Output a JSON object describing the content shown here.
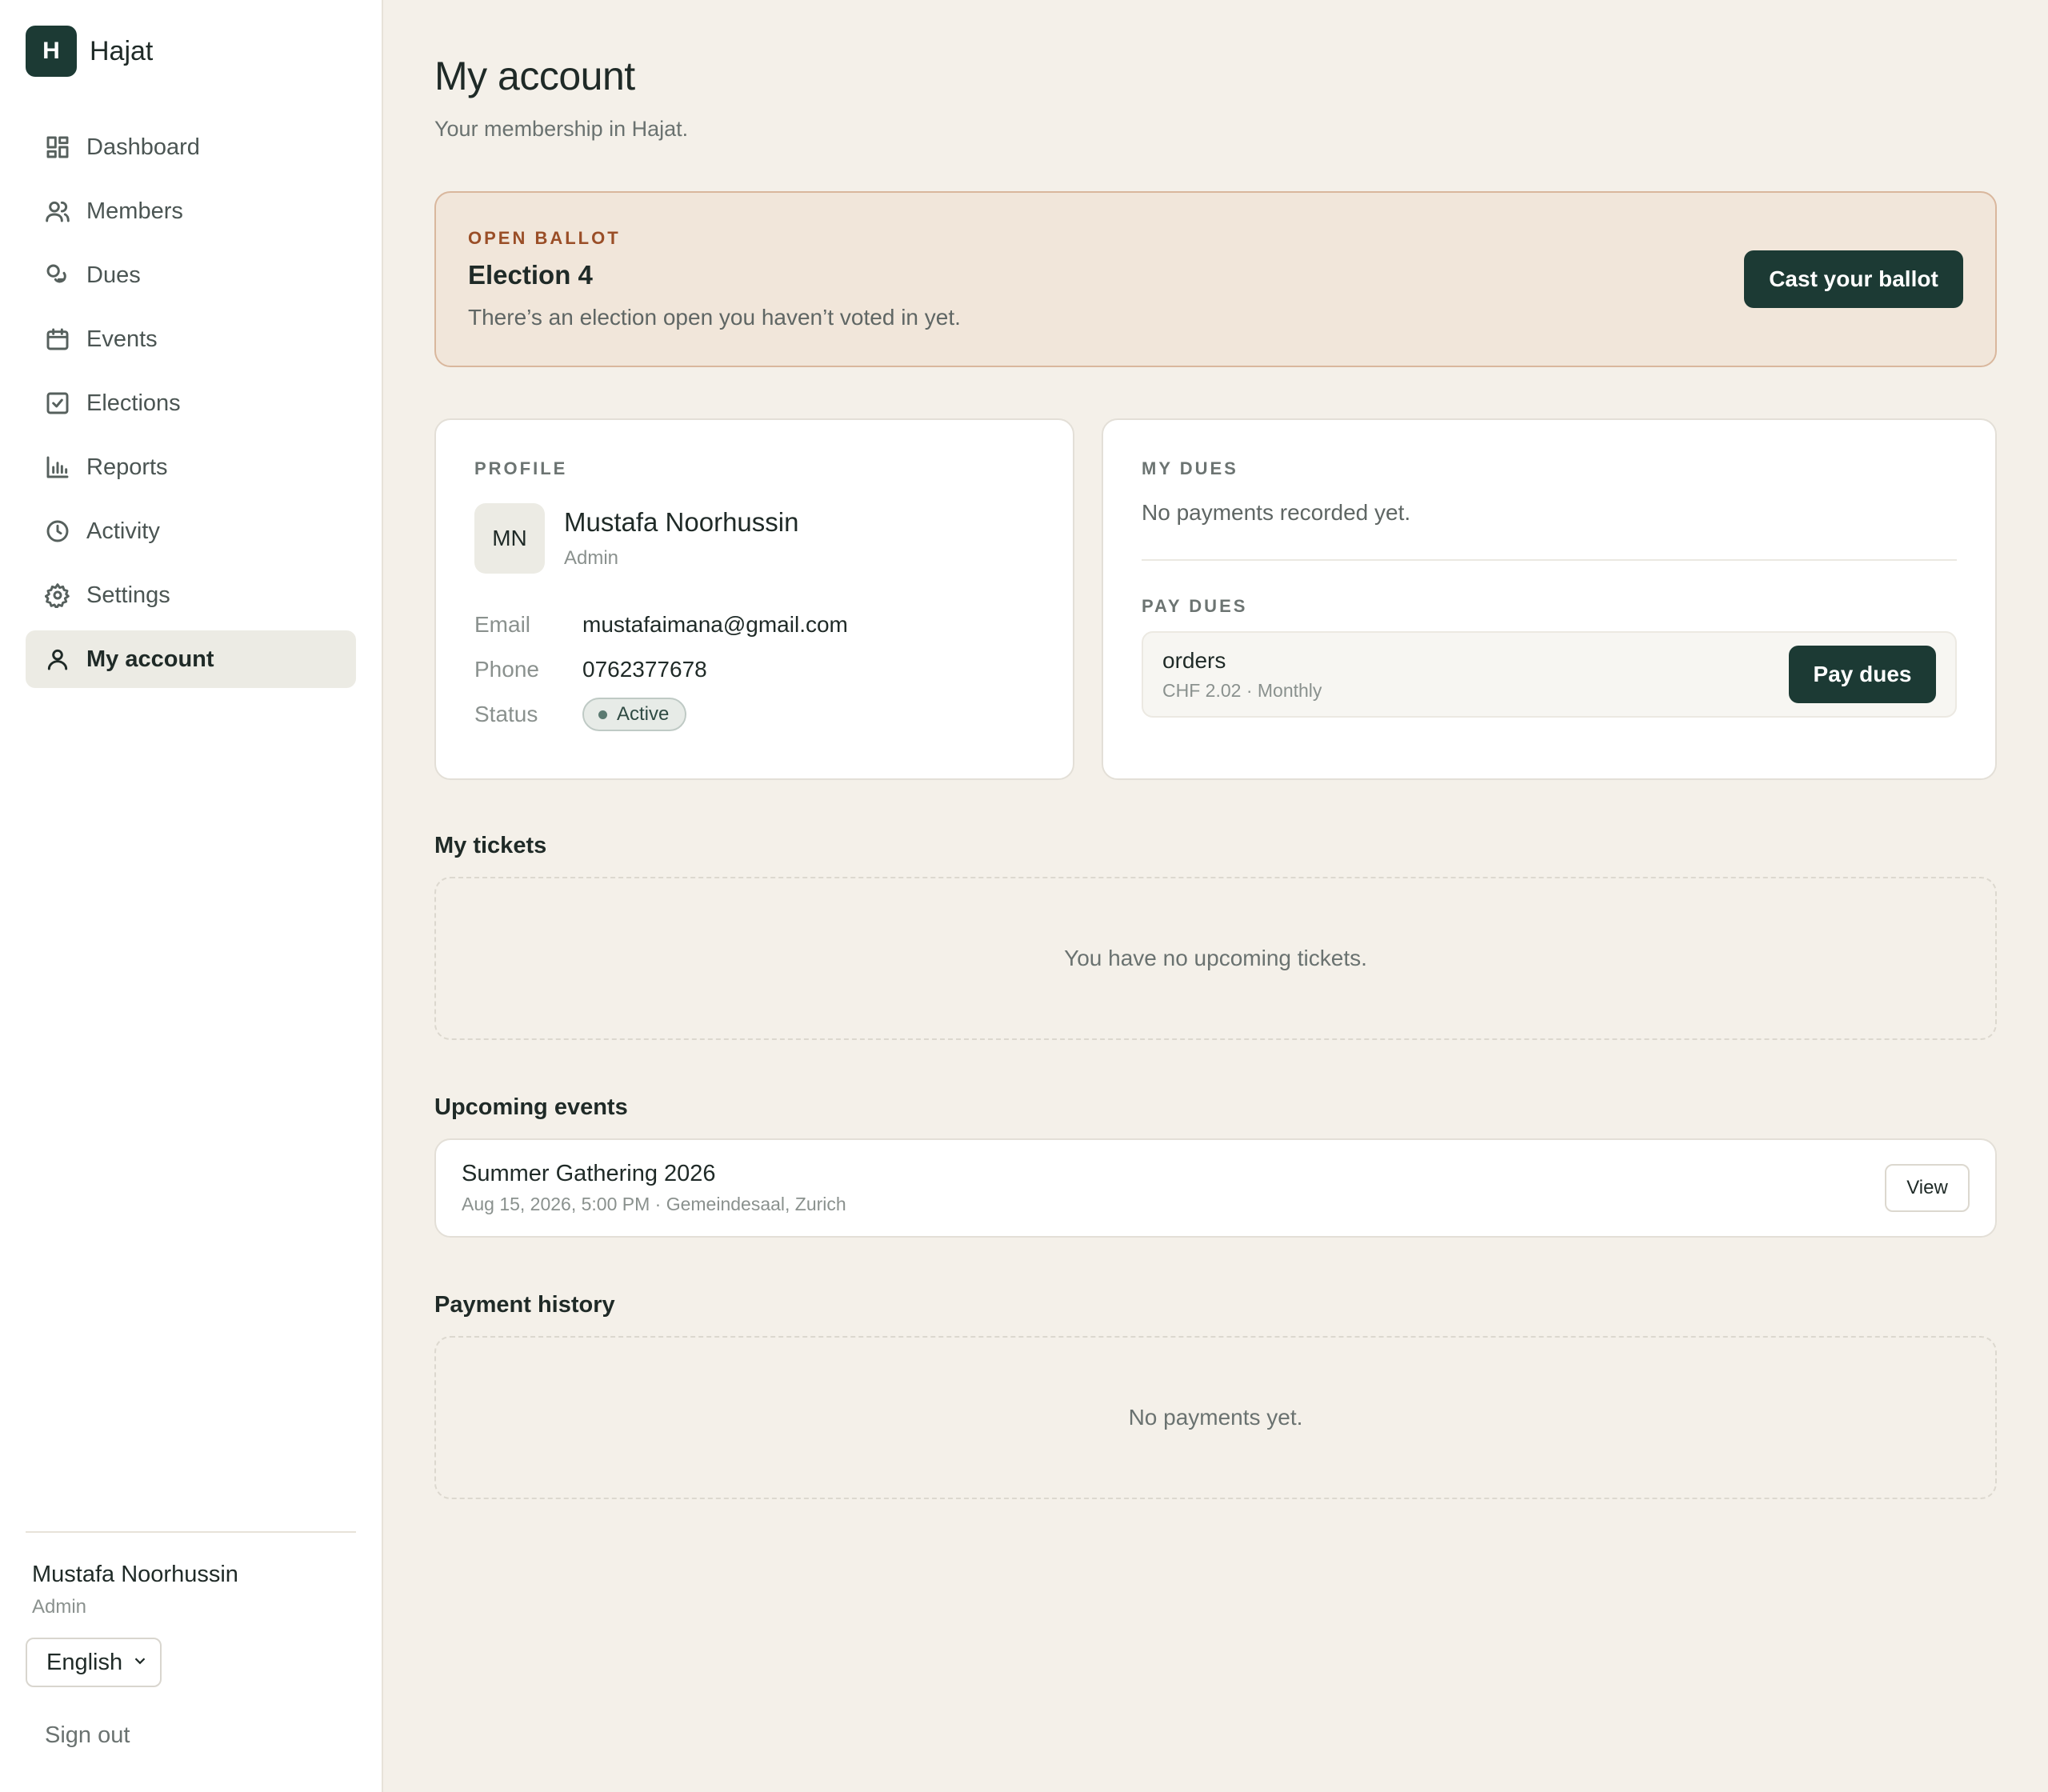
{
  "brand": {
    "logo_letter": "H",
    "name": "Hajat"
  },
  "nav": {
    "items": [
      {
        "label": "Dashboard",
        "icon": "dashboard-icon"
      },
      {
        "label": "Members",
        "icon": "members-icon"
      },
      {
        "label": "Dues",
        "icon": "dues-icon"
      },
      {
        "label": "Events",
        "icon": "calendar-icon"
      },
      {
        "label": "Elections",
        "icon": "checkbox-icon"
      },
      {
        "label": "Reports",
        "icon": "bar-chart-icon"
      },
      {
        "label": "Activity",
        "icon": "clock-icon"
      },
      {
        "label": "Settings",
        "icon": "gear-icon"
      },
      {
        "label": "My account",
        "icon": "user-icon",
        "active": true
      }
    ]
  },
  "sidebar_footer": {
    "user_name": "Mustafa Noorhussin",
    "user_role": "Admin",
    "language": "English",
    "sign_out": "Sign out"
  },
  "page": {
    "title": "My account",
    "subtitle": "Your membership in Hajat."
  },
  "ballot": {
    "kicker": "OPEN BALLOT",
    "title": "Election 4",
    "description": "There’s an election open you haven’t voted in yet.",
    "button": "Cast your ballot"
  },
  "profile": {
    "kicker": "PROFILE",
    "initials": "MN",
    "name": "Mustafa Noorhussin",
    "role": "Admin",
    "email_label": "Email",
    "email": "mustafaimana@gmail.com",
    "phone_label": "Phone",
    "phone": "0762377678",
    "status_label": "Status",
    "status": "Active"
  },
  "dues": {
    "kicker": "MY DUES",
    "empty": "No payments recorded yet.",
    "pay_kicker": "PAY DUES",
    "item_name": "orders",
    "item_meta": "CHF 2.02 · Monthly",
    "pay_button": "Pay dues"
  },
  "tickets": {
    "title": "My tickets",
    "empty": "You have no upcoming tickets."
  },
  "events": {
    "title": "Upcoming events",
    "items": [
      {
        "name": "Summer Gathering 2026",
        "meta": "Aug 15, 2026, 5:00 PM · Gemeindesaal, Zurich",
        "button": "View"
      }
    ]
  },
  "payments": {
    "title": "Payment history",
    "empty": "No payments yet."
  },
  "colors": {
    "accent": "#1c3a34",
    "background": "#f4f0e9",
    "ballot_bg": "#f1e6da",
    "ballot_kicker": "#9a4e27"
  }
}
